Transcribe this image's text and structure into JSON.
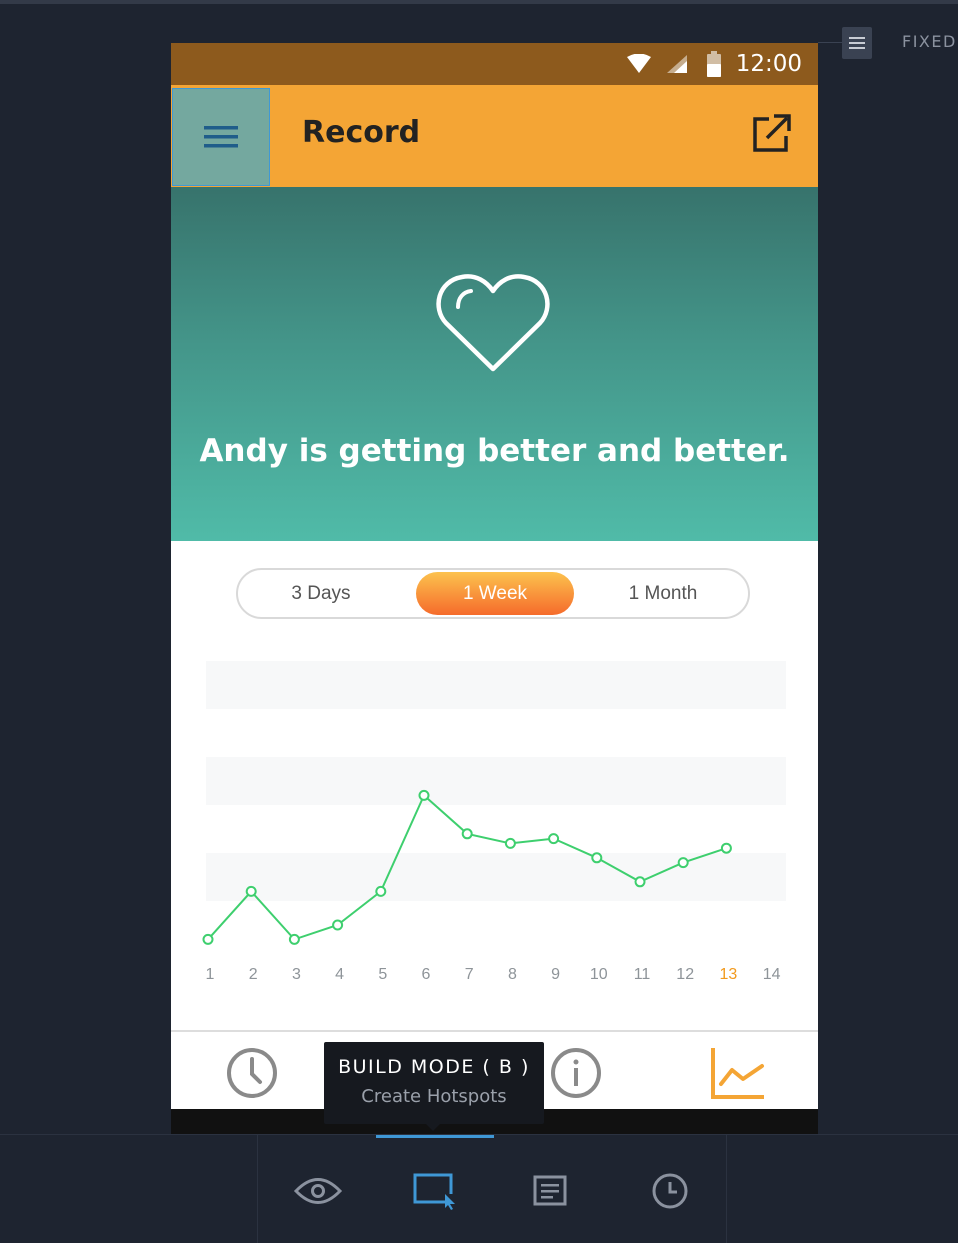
{
  "workspace": {
    "fixed_label": "FIXED",
    "fixed_button_icon": "hamburger-icon"
  },
  "status_bar": {
    "time": "12:00",
    "icons": [
      "wifi-icon",
      "signal-icon",
      "battery-icon"
    ]
  },
  "app_bar": {
    "title": "Record",
    "menu_icon": "hamburger-icon",
    "share_icon": "external-link-icon"
  },
  "hero": {
    "icon": "heart-icon",
    "message": "Andy is getting better and better."
  },
  "range_selector": {
    "options": [
      "3 Days",
      "1 Week",
      "1 Month"
    ],
    "selected": "1 Week"
  },
  "chart_data": {
    "type": "line",
    "x": [
      1,
      2,
      3,
      4,
      5,
      6,
      7,
      8,
      9,
      10,
      11,
      12,
      13
    ],
    "x_ticks": [
      "1",
      "2",
      "3",
      "4",
      "5",
      "6",
      "7",
      "8",
      "9",
      "10",
      "11",
      "12",
      "13",
      "14"
    ],
    "highlighted_tick": "13",
    "values": [
      0.2,
      1.2,
      0.2,
      0.5,
      1.2,
      3.2,
      2.4,
      2.2,
      2.3,
      1.9,
      1.4,
      1.8,
      2.1
    ],
    "ylim": [
      0,
      6
    ],
    "grid": "horizontal bands",
    "line_color": "#3ecf6e",
    "highlight_color": "#f29a1e"
  },
  "tab_bar": {
    "tabs": [
      "clock-icon",
      "info-icon",
      "chart-icon"
    ],
    "active_color": "#f4a535"
  },
  "tooltip": {
    "title": "BUILD MODE ( B )",
    "subtitle": "Create Hotspots"
  },
  "toolbar": {
    "buttons": [
      "preview-eye-icon",
      "build-mode-icon",
      "comments-icon",
      "history-icon"
    ],
    "active": "build-mode-icon",
    "accent": "#3f98d6"
  }
}
